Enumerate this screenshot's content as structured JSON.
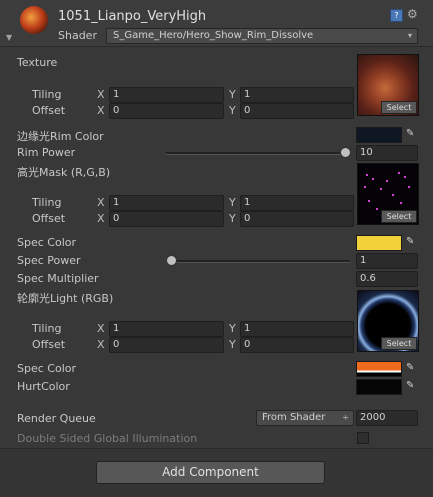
{
  "header": {
    "title": "1051_Lianpo_VeryHigh",
    "shader_label": "Shader",
    "shader_value": "S_Game_Hero/Hero_Show_Rim_Dissolve",
    "help_glyph": "?",
    "gear_glyph": "⚙",
    "fold_glyph": "▼",
    "dropdown_arrow": "▾"
  },
  "properties": {
    "texture": {
      "label": "Texture",
      "tiling_label": "Tiling",
      "offset_label": "Offset",
      "tiling_x": "1",
      "tiling_y": "1",
      "offset_x": "0",
      "offset_y": "0",
      "select": "Select"
    },
    "rim_color": {
      "label": "边缘光Rim Color",
      "color": "#0e1722"
    },
    "rim_power": {
      "label": "Rim Power",
      "value": "10",
      "fraction": 1.0
    },
    "highlight_mask": {
      "label": "高光Mask (R,G,B)",
      "tiling_label": "Tiling",
      "offset_label": "Offset",
      "tiling_x": "1",
      "tiling_y": "1",
      "offset_x": "0",
      "offset_y": "0",
      "select": "Select"
    },
    "spec_color": {
      "label": "Spec Color",
      "color": "#f2d23a"
    },
    "spec_power": {
      "label": "Spec Power",
      "value": "1",
      "fraction": 0.0
    },
    "spec_multiplier": {
      "label": "Spec Multiplier",
      "value": "0.6"
    },
    "outline_light": {
      "label": "轮廓光Light (RGB)",
      "tiling_label": "Tiling",
      "offset_label": "Offset",
      "tiling_x": "1",
      "tiling_y": "1",
      "offset_x": "0",
      "offset_y": "0",
      "select": "Select"
    },
    "spec_color_2": {
      "label": "Spec Color",
      "color": "#f06a1e"
    },
    "hurt_color": {
      "label": "HurtColor",
      "color": "#050505"
    },
    "render_queue": {
      "label": "Render Queue",
      "mode": "From Shader",
      "value": "2000",
      "arrow": "÷"
    },
    "double_sided_gi": {
      "label": "Double Sided Global Illumination"
    }
  },
  "axis": {
    "x": "X",
    "y": "Y"
  },
  "picker_glyph": "✎",
  "footer": {
    "add_component": "Add Component"
  }
}
